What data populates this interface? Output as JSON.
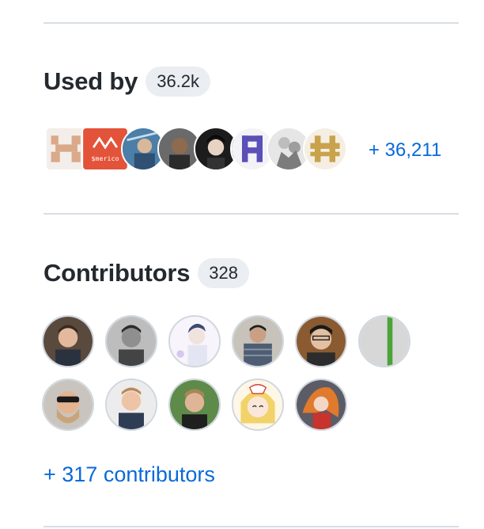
{
  "used_by": {
    "title": "Used by",
    "count": "36.2k",
    "more_link": "+ 36,211",
    "avatars": [
      {
        "name": "used-by-avatar-1",
        "icon": "pixel-h-logo-icon"
      },
      {
        "name": "used-by-avatar-2",
        "icon": "merico-logo-icon",
        "text": "$merico"
      },
      {
        "name": "used-by-avatar-3",
        "icon": "user-photo-icon"
      },
      {
        "name": "used-by-avatar-4",
        "icon": "user-photo-icon"
      },
      {
        "name": "used-by-avatar-5",
        "icon": "user-photo-icon"
      },
      {
        "name": "used-by-avatar-6",
        "icon": "pixel-a-logo-icon"
      },
      {
        "name": "used-by-avatar-7",
        "icon": "anime-art-icon"
      },
      {
        "name": "used-by-avatar-8",
        "icon": "gold-pixel-logo-icon"
      }
    ]
  },
  "contributors": {
    "title": "Contributors",
    "count": "328",
    "more_link": "+ 317 contributors",
    "avatars": [
      {
        "name": "contributor-avatar-1",
        "icon": "user-photo-icon"
      },
      {
        "name": "contributor-avatar-2",
        "icon": "user-photo-icon"
      },
      {
        "name": "contributor-avatar-3",
        "icon": "anime-art-icon"
      },
      {
        "name": "contributor-avatar-4",
        "icon": "user-photo-icon"
      },
      {
        "name": "contributor-avatar-5",
        "icon": "user-photo-icon"
      },
      {
        "name": "contributor-avatar-6",
        "icon": "green-stripe-icon"
      },
      {
        "name": "contributor-avatar-7",
        "icon": "user-photo-icon"
      },
      {
        "name": "contributor-avatar-8",
        "icon": "user-photo-icon"
      },
      {
        "name": "contributor-avatar-9",
        "icon": "user-photo-icon"
      },
      {
        "name": "contributor-avatar-10",
        "icon": "anime-art-icon"
      },
      {
        "name": "contributor-avatar-11",
        "icon": "anime-art-icon"
      }
    ]
  },
  "colors": {
    "link": "#0969da",
    "badge_bg": "#eaeef2",
    "divider": "#d8dee4",
    "text": "#24292f"
  }
}
